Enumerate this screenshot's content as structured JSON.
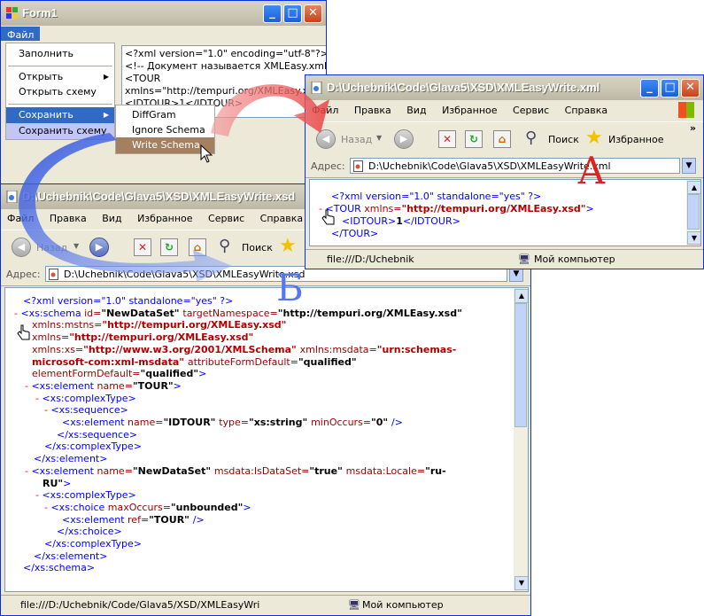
{
  "form1": {
    "title": "Form1",
    "menu_file": "Файл",
    "file_menu": {
      "items": [
        "Заполнить",
        "Открыть",
        "Открыть схему",
        "Сохранить",
        "Сохранить схему"
      ]
    },
    "save_submenu": {
      "items": [
        "DiffGram",
        "Ignore Schema",
        "Write Schema"
      ]
    },
    "textbox_lines": [
      "<?xml version=\"1.0\" encoding=\"utf-8\"?>",
      "<!-- Документ называется XMLEasy.xml  -->",
      "<TOUR",
      "xmlns=\"http://tempuri.org/XMLEasy.xsd\">",
      "    <IDTOUR>1</IDTOUR>"
    ]
  },
  "xml_window": {
    "title": "D:\\Uchebnik\\Code\\Glava5\\XSD\\XMLEasyWrite.xml",
    "menu": [
      "Файл",
      "Правка",
      "Вид",
      "Избранное",
      "Сервис",
      "Справка"
    ],
    "toolbar": {
      "back": "Назад",
      "search": "Поиск",
      "favorites": "Избранное",
      "more": "»"
    },
    "address_label": "Адрес:",
    "address": "D:\\Uchebnik\\Code\\Glava5\\XSD\\XMLEasyWrite.xml",
    "status_left": "file:///D:/Uchebnik",
    "status_right": "Мой компьютер",
    "content": {
      "decl": "<?xml version=\"1.0\" standalone=\"yes\" ?>",
      "minus": "-",
      "tour_open": "<TOUR",
      "xmlns_attr": "xmlns=",
      "xmlns_val": "\"http://tempuri.org/XMLEasy.xsd\"",
      "gt": ">",
      "idtour_open": "<IDTOUR>",
      "idtour_val": "1",
      "idtour_close": "</IDTOUR>",
      "tour_close": "</TOUR>"
    }
  },
  "xsd_window": {
    "title": "D:\\Uchebnik\\Code\\Glava5\\XSD\\XMLEasyWrite.xsd",
    "menu": [
      "Файл",
      "Правка",
      "Вид",
      "Избранное",
      "Сервис",
      "Справка"
    ],
    "toolbar": {
      "back": "Назад",
      "search": "Поиск"
    },
    "address_label": "Адрес:",
    "address": "D:\\Uchebnik\\Code\\Glava5\\XSD\\XMLEasyWrite.xsd",
    "status_left": "file:///D:/Uchebnik/Code/Glava5/XSD/XMLEasyWri",
    "status_right": "Мой компьютер"
  },
  "labels": {
    "a": "А",
    "b": "Б"
  },
  "colors": {
    "arrow_red": "#ee5a5a",
    "arrow_blue": "#4466dd",
    "label_red": "#dd2222",
    "label_blue": "#5577ee"
  }
}
